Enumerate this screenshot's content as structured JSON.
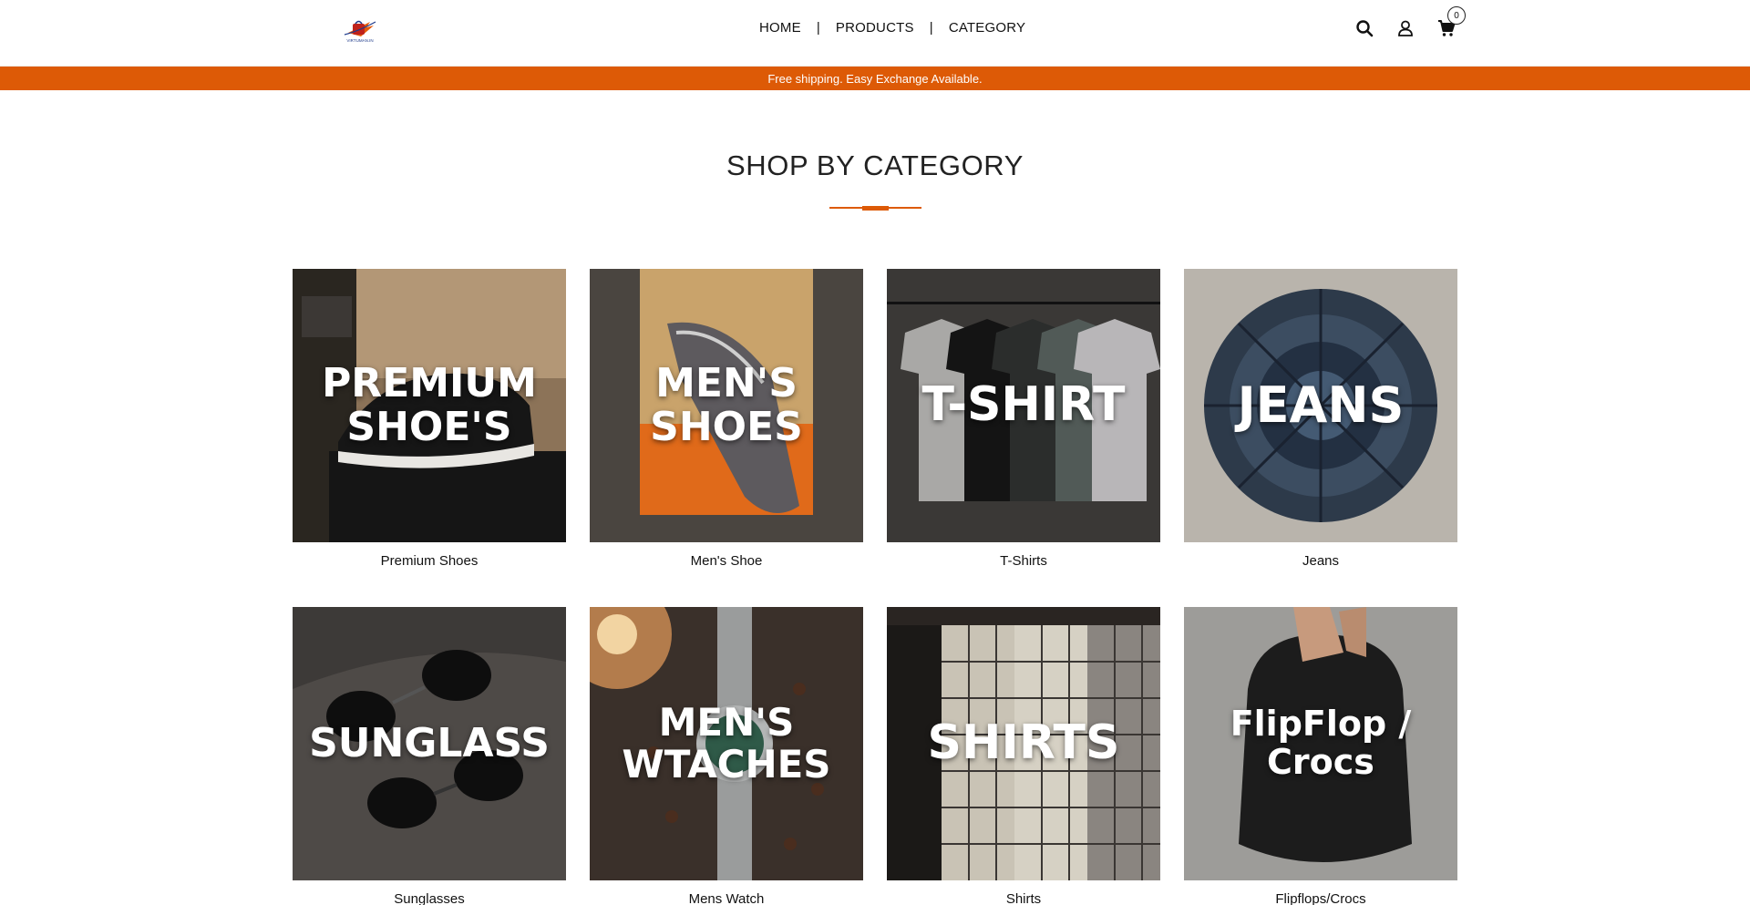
{
  "header": {
    "logo_text": "VIRTUMAN.IN",
    "nav": [
      {
        "label": "HOME"
      },
      {
        "label": "PRODUCTS"
      },
      {
        "label": "CATEGORY"
      }
    ],
    "separator": "|",
    "cart_count": "0",
    "icons": [
      "search-icon",
      "account-icon",
      "cart-icon"
    ]
  },
  "promo": {
    "text": "Free shipping. Easy Exchange Available.",
    "color": "#dd5a06"
  },
  "section": {
    "title": "SHOP BY CATEGORY",
    "accent": "#dd5a06"
  },
  "categories": [
    {
      "overlay": "PREMIUM SHOE'S",
      "caption": "Premium Shoes",
      "theme": "shoe-box"
    },
    {
      "overlay": "MEN'S SHOES",
      "caption": "Men's Shoe",
      "theme": "sneaker-box"
    },
    {
      "overlay": "T-SHIRT",
      "caption": "T-Shirts",
      "theme": "tshirt-rack"
    },
    {
      "overlay": "JEANS",
      "caption": "Jeans",
      "theme": "jeans-circle"
    },
    {
      "overlay": "SUNGLASS",
      "caption": "Sunglasses",
      "theme": "sunglasses"
    },
    {
      "overlay": "MEN'S WTACHES",
      "caption": "Mens Watch",
      "theme": "watch-coffee"
    },
    {
      "overlay": "SHIRTS",
      "caption": "Shirts",
      "theme": "shirt-rack"
    },
    {
      "overlay": "FlipFlop / Crocs",
      "caption": "Flipflops/Crocs",
      "theme": "slides"
    }
  ]
}
